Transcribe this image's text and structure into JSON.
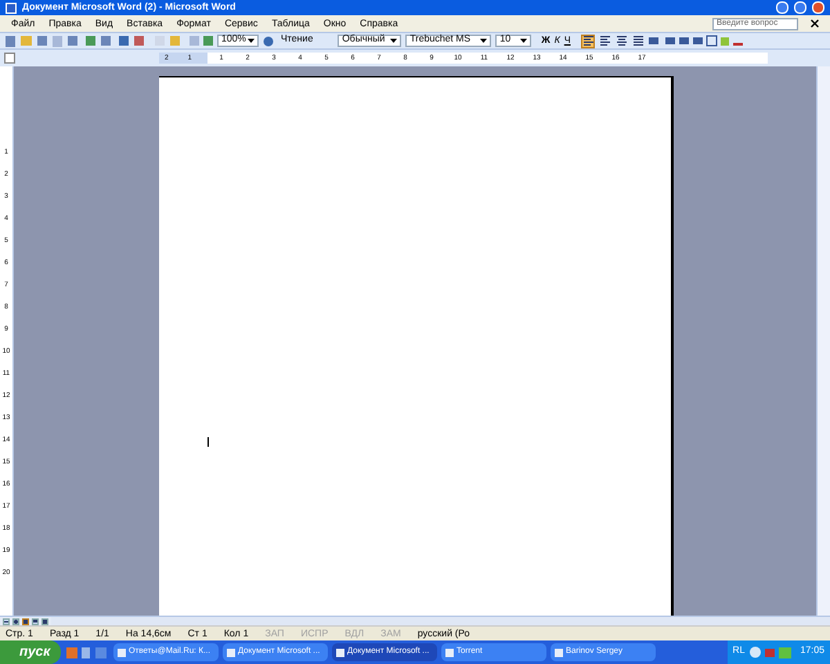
{
  "window": {
    "title": "Документ Microsoft Word (2) - Microsoft Word"
  },
  "menu": [
    "Файл",
    "Правка",
    "Вид",
    "Вставка",
    "Формат",
    "Сервис",
    "Таблица",
    "Окно",
    "Справка"
  ],
  "help_box": {
    "placeholder": "Введите вопрос"
  },
  "toolbar": {
    "zoom": "100%",
    "reading": "Чтение",
    "style": "Обычный",
    "font": "Trebuchet MS",
    "size": "10",
    "format_buttons": [
      {
        "label": "Ж",
        "kind": "bold"
      },
      {
        "label": "К",
        "kind": "italic"
      },
      {
        "label": "Ч",
        "kind": "underline"
      }
    ],
    "align": [
      {
        "kind": "left",
        "selected": true
      },
      {
        "kind": "center",
        "selected": false
      },
      {
        "kind": "right",
        "selected": false
      },
      {
        "kind": "justify",
        "selected": false
      }
    ]
  },
  "ruler": {
    "left_numbers": [
      "2",
      "1"
    ],
    "numbers": [
      "1",
      "2",
      "3",
      "4",
      "5",
      "6",
      "7",
      "8",
      "9",
      "10",
      "11",
      "12",
      "13",
      "14",
      "15",
      "16",
      "17"
    ]
  },
  "vertical_ruler": [
    "1",
    "2",
    "3",
    "4",
    "5",
    "6",
    "7",
    "8",
    "9",
    "10",
    "11",
    "12",
    "13",
    "14",
    "15",
    "16",
    "17",
    "18",
    "19",
    "20"
  ],
  "view_buttons": [
    {
      "kind": "normal",
      "selected": false
    },
    {
      "kind": "web",
      "selected": false
    },
    {
      "kind": "print",
      "selected": true
    },
    {
      "kind": "outline",
      "selected": false
    },
    {
      "kind": "reading",
      "selected": false
    }
  ],
  "status_bar": [
    {
      "text": "Стр. 1",
      "disabled": false
    },
    {
      "text": "Разд 1",
      "disabled": false
    },
    {
      "text": "1/1",
      "disabled": false
    },
    {
      "text": "На 14,6см",
      "disabled": false
    },
    {
      "text": "Ст 1",
      "disabled": false
    },
    {
      "text": "Кол 1",
      "disabled": false
    },
    {
      "text": "ЗАП",
      "disabled": true
    },
    {
      "text": "ИСПР",
      "disabled": true
    },
    {
      "text": "ВДЛ",
      "disabled": true
    },
    {
      "text": "ЗАМ",
      "disabled": true
    },
    {
      "text": "русский (Ро",
      "disabled": false
    }
  ],
  "taskbar": {
    "start": "пуск",
    "tasks": [
      {
        "label": "Ответы@Mail.Ru: К...",
        "selected": false
      },
      {
        "label": "Документ Microsoft ...",
        "selected": false
      },
      {
        "label": "Документ Microsoft ...",
        "selected": true
      },
      {
        "label": "Torrent",
        "selected": false
      },
      {
        "label": "Barinov Sergey",
        "selected": false
      }
    ],
    "language": "RL",
    "clock": "17:05"
  }
}
